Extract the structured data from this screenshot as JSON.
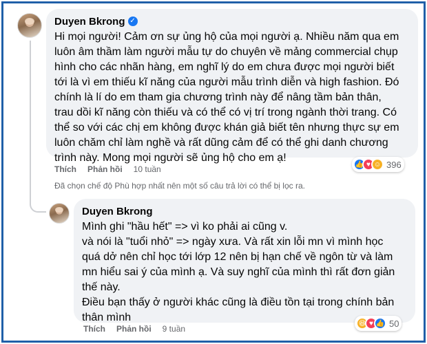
{
  "comment": {
    "author": "Duyen Bkrong",
    "text": "Hi mọi người! Cảm ơn sự ủng hộ của mọi người ạ. Nhiều năm qua em\nluôn âm thầm làm người mẫu tự do chuyên về mảng commercial chụp\nhình cho các nhãn hàng, em nghĩ lý do em chưa được mọi người biết\ntới là vì em thiếu kĩ năng của người mẫu trình diễn và high fashion. Đó\nchính là lí do em tham gia chương trình này để nâng tầm bản thân,\ntrau dồi kĩ năng còn thiếu và có thể có vị trí trong ngành thời trang. Có\nthể so với các chị em không được khán giả biết tên nhưng thực sự em\nluôn chăm chỉ làm nghề và rất dũng cảm để có thể ghi danh chương\ntrình này. Mong mọi người sẽ ủng hộ cho em ạ!",
    "like_label": "Thích",
    "reply_label": "Phản hồi",
    "time": "10 tuần",
    "reaction_count": "396",
    "reactions": [
      "like-icon",
      "love-icon",
      "care-icon"
    ]
  },
  "filter_note": "Đã chọn chế độ Phù hợp nhất nên một số câu trả lời có thể bị lọc ra.",
  "reply": {
    "author": "Duyen Bkrong",
    "text": "Mình ghi \"hầu hết\" => vì ko phải ai cũng v.\nvà nói là \"tuổi nhỏ\" => ngày xưa. Và rất xin lỗi mn vì mình học\nquá dở nên chỉ học tới lớp 12 nên bị hạn chế về ngôn từ và làm\nmn hiểu sai ý của mình ạ. Và suy nghĩ của mình thì rất đơn giản\nthế này.\nĐiều bạn thấy ở người khác cũng là điều tồn tại trong chính bản\nthân mình",
    "like_label": "Thích",
    "reply_label": "Phản hồi",
    "time": "9 tuần",
    "reaction_count": "50",
    "reactions": [
      "haha-icon",
      "love-icon",
      "like-icon"
    ]
  },
  "colors": {
    "frame_border": "#1f5fa8",
    "bubble_bg": "#f0f2f5",
    "meta_text": "#65676b",
    "verified": "#1877f2"
  }
}
